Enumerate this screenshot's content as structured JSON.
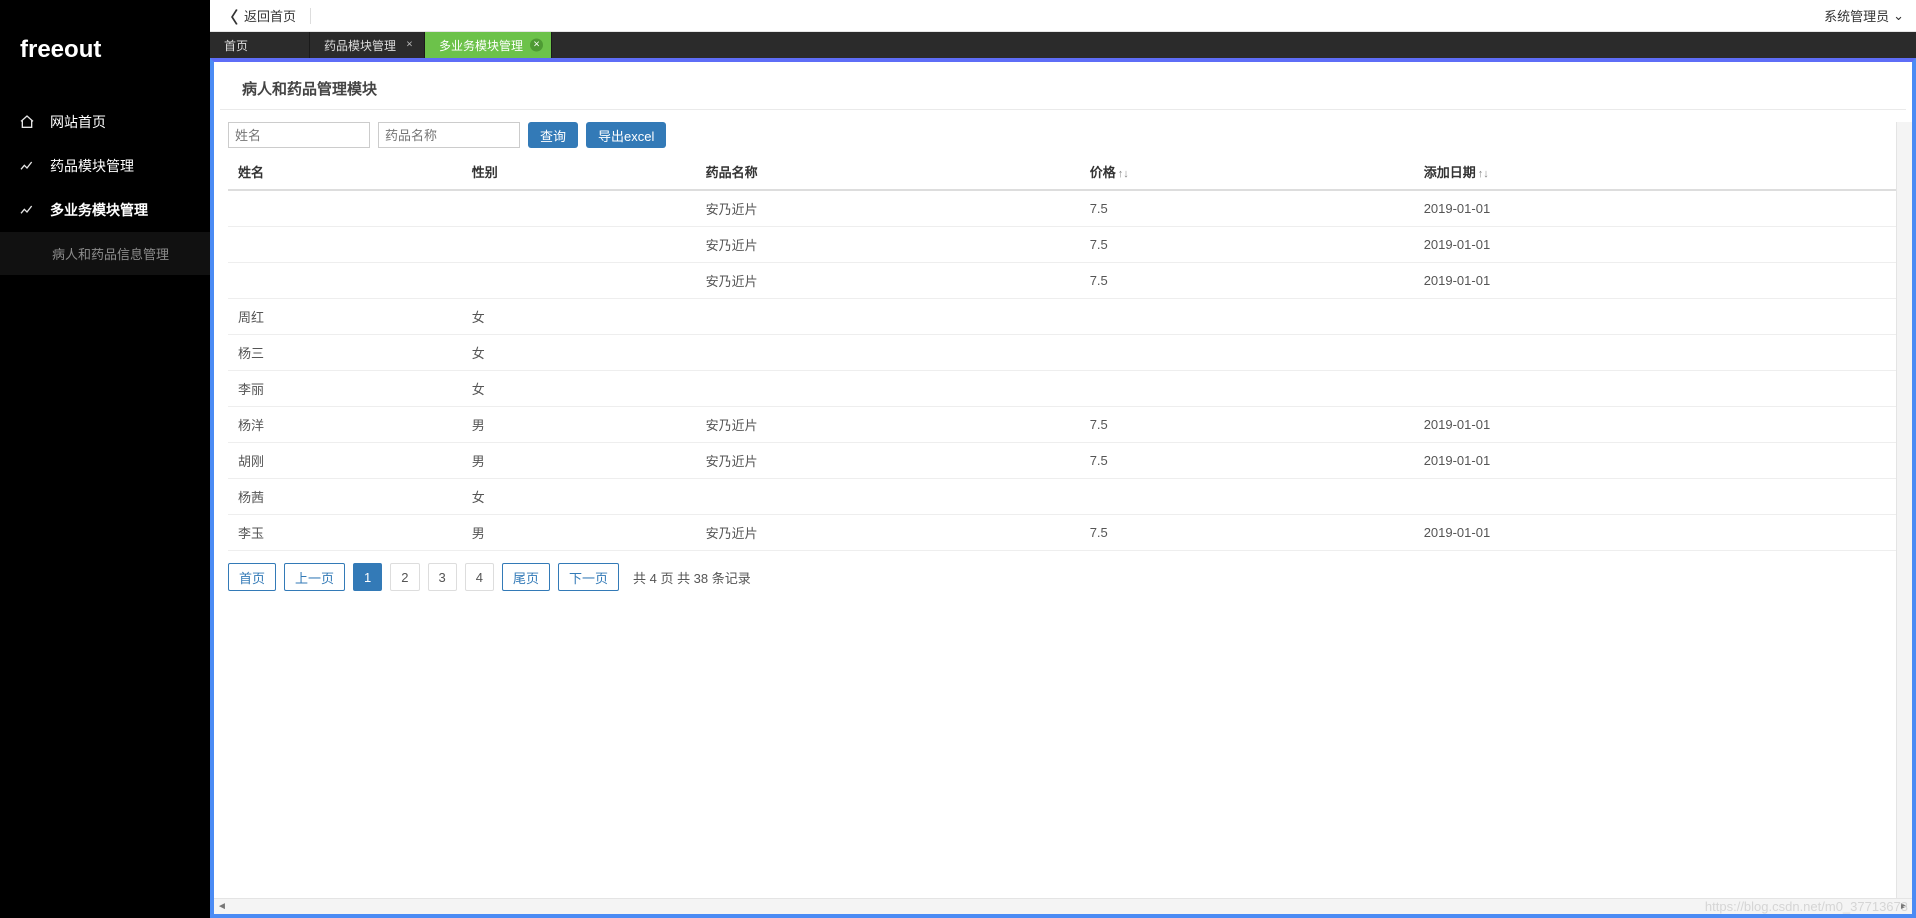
{
  "brand": "freeout",
  "sidebar": {
    "items": [
      {
        "label": "网站首页",
        "icon": "home"
      },
      {
        "label": "药品模块管理",
        "icon": "chart"
      },
      {
        "label": "多业务模块管理",
        "icon": "chart"
      }
    ],
    "sub": {
      "label": "病人和药品信息管理"
    }
  },
  "topbar": {
    "back": "返回首页",
    "user": "系统管理员"
  },
  "tabs": [
    {
      "label": "首页",
      "closable": false
    },
    {
      "label": "药品模块管理",
      "closable": true
    },
    {
      "label": "多业务模块管理",
      "closable": true,
      "active": true
    }
  ],
  "module_title": "病人和药品管理模块",
  "filters": {
    "name_placeholder": "姓名",
    "drug_placeholder": "药品名称",
    "query_btn": "查询",
    "export_btn": "导出excel"
  },
  "columns": {
    "name": "姓名",
    "gender": "性别",
    "drug": "药品名称",
    "price": "价格",
    "date": "添加日期",
    "sort_arrows": "↑↓"
  },
  "rows": [
    {
      "name": "",
      "gender": "",
      "drug": "安乃近片",
      "price": "7.5",
      "date": "2019-01-01"
    },
    {
      "name": "",
      "gender": "",
      "drug": "安乃近片",
      "price": "7.5",
      "date": "2019-01-01"
    },
    {
      "name": "",
      "gender": "",
      "drug": "安乃近片",
      "price": "7.5",
      "date": "2019-01-01"
    },
    {
      "name": "周红",
      "gender": "女",
      "drug": "",
      "price": "",
      "date": ""
    },
    {
      "name": "杨三",
      "gender": "女",
      "drug": "",
      "price": "",
      "date": ""
    },
    {
      "name": "李丽",
      "gender": "女",
      "drug": "",
      "price": "",
      "date": ""
    },
    {
      "name": "杨洋",
      "gender": "男",
      "drug": "安乃近片",
      "price": "7.5",
      "date": "2019-01-01"
    },
    {
      "name": "胡刚",
      "gender": "男",
      "drug": "安乃近片",
      "price": "7.5",
      "date": "2019-01-01"
    },
    {
      "name": "杨茜",
      "gender": "女",
      "drug": "",
      "price": "",
      "date": ""
    },
    {
      "name": "李玉",
      "gender": "男",
      "drug": "安乃近片",
      "price": "7.5",
      "date": "2019-01-01"
    }
  ],
  "pager": {
    "first": "首页",
    "prev": "上一页",
    "pages": [
      "1",
      "2",
      "3",
      "4"
    ],
    "current": "1",
    "last": "尾页",
    "next": "下一页",
    "summary": "共 4 页 共 38 条记录"
  },
  "watermark": "https://blog.csdn.net/m0_37713673"
}
